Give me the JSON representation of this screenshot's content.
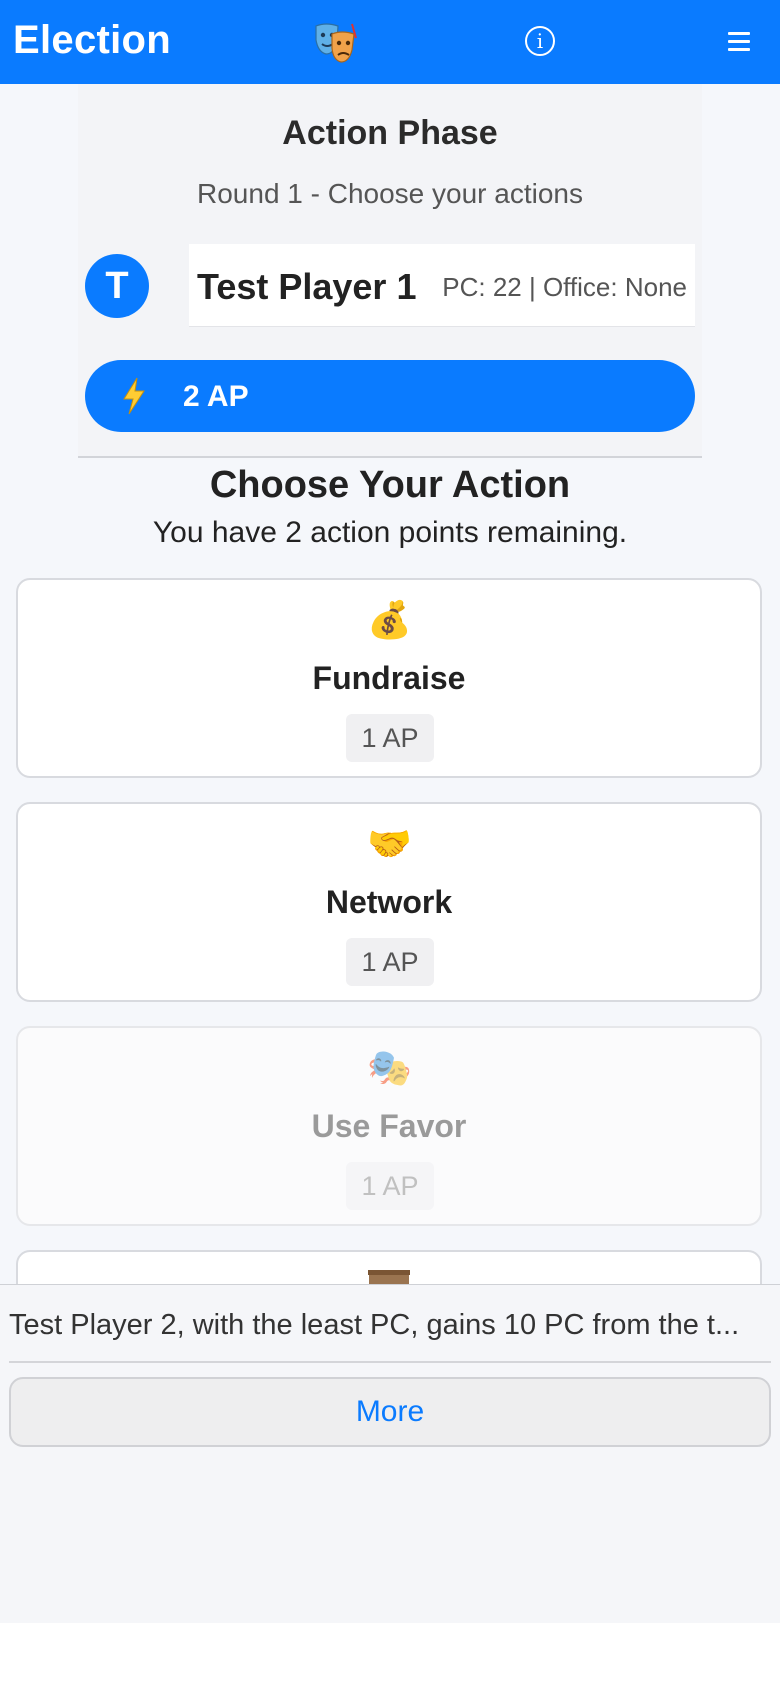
{
  "header": {
    "title": "Election",
    "logo_icon": "theater-masks-icon",
    "info_icon": "info-icon",
    "menu_icon": "hamburger-menu-icon",
    "brand_color": "#0a7bff"
  },
  "phase": {
    "title": "Action Phase",
    "subtitle": "Round 1 - Choose your actions"
  },
  "player": {
    "avatar_letter": "T",
    "name": "Test Player 1",
    "stats": "PC: 22 | Office: None"
  },
  "ap_bar": {
    "icon": "lightning-icon",
    "value": "2 AP"
  },
  "choose": {
    "title": "Choose Your Action",
    "subtitle": "You have 2 action points remaining."
  },
  "actions": [
    {
      "icon": "💰",
      "icon_name": "money-bag-icon",
      "name": "Fundraise",
      "cost": "1 AP",
      "enabled": true
    },
    {
      "icon": "🤝",
      "icon_name": "handshake-icon",
      "name": "Network",
      "cost": "1 AP",
      "enabled": true
    },
    {
      "icon": "🎭",
      "icon_name": "theater-masks-icon",
      "name": "Use Favor",
      "cost": "1 AP",
      "enabled": false
    }
  ],
  "log": {
    "text": "Test Player 2, with the least PC, gains 10 PC from the t...",
    "more_label": "More"
  }
}
